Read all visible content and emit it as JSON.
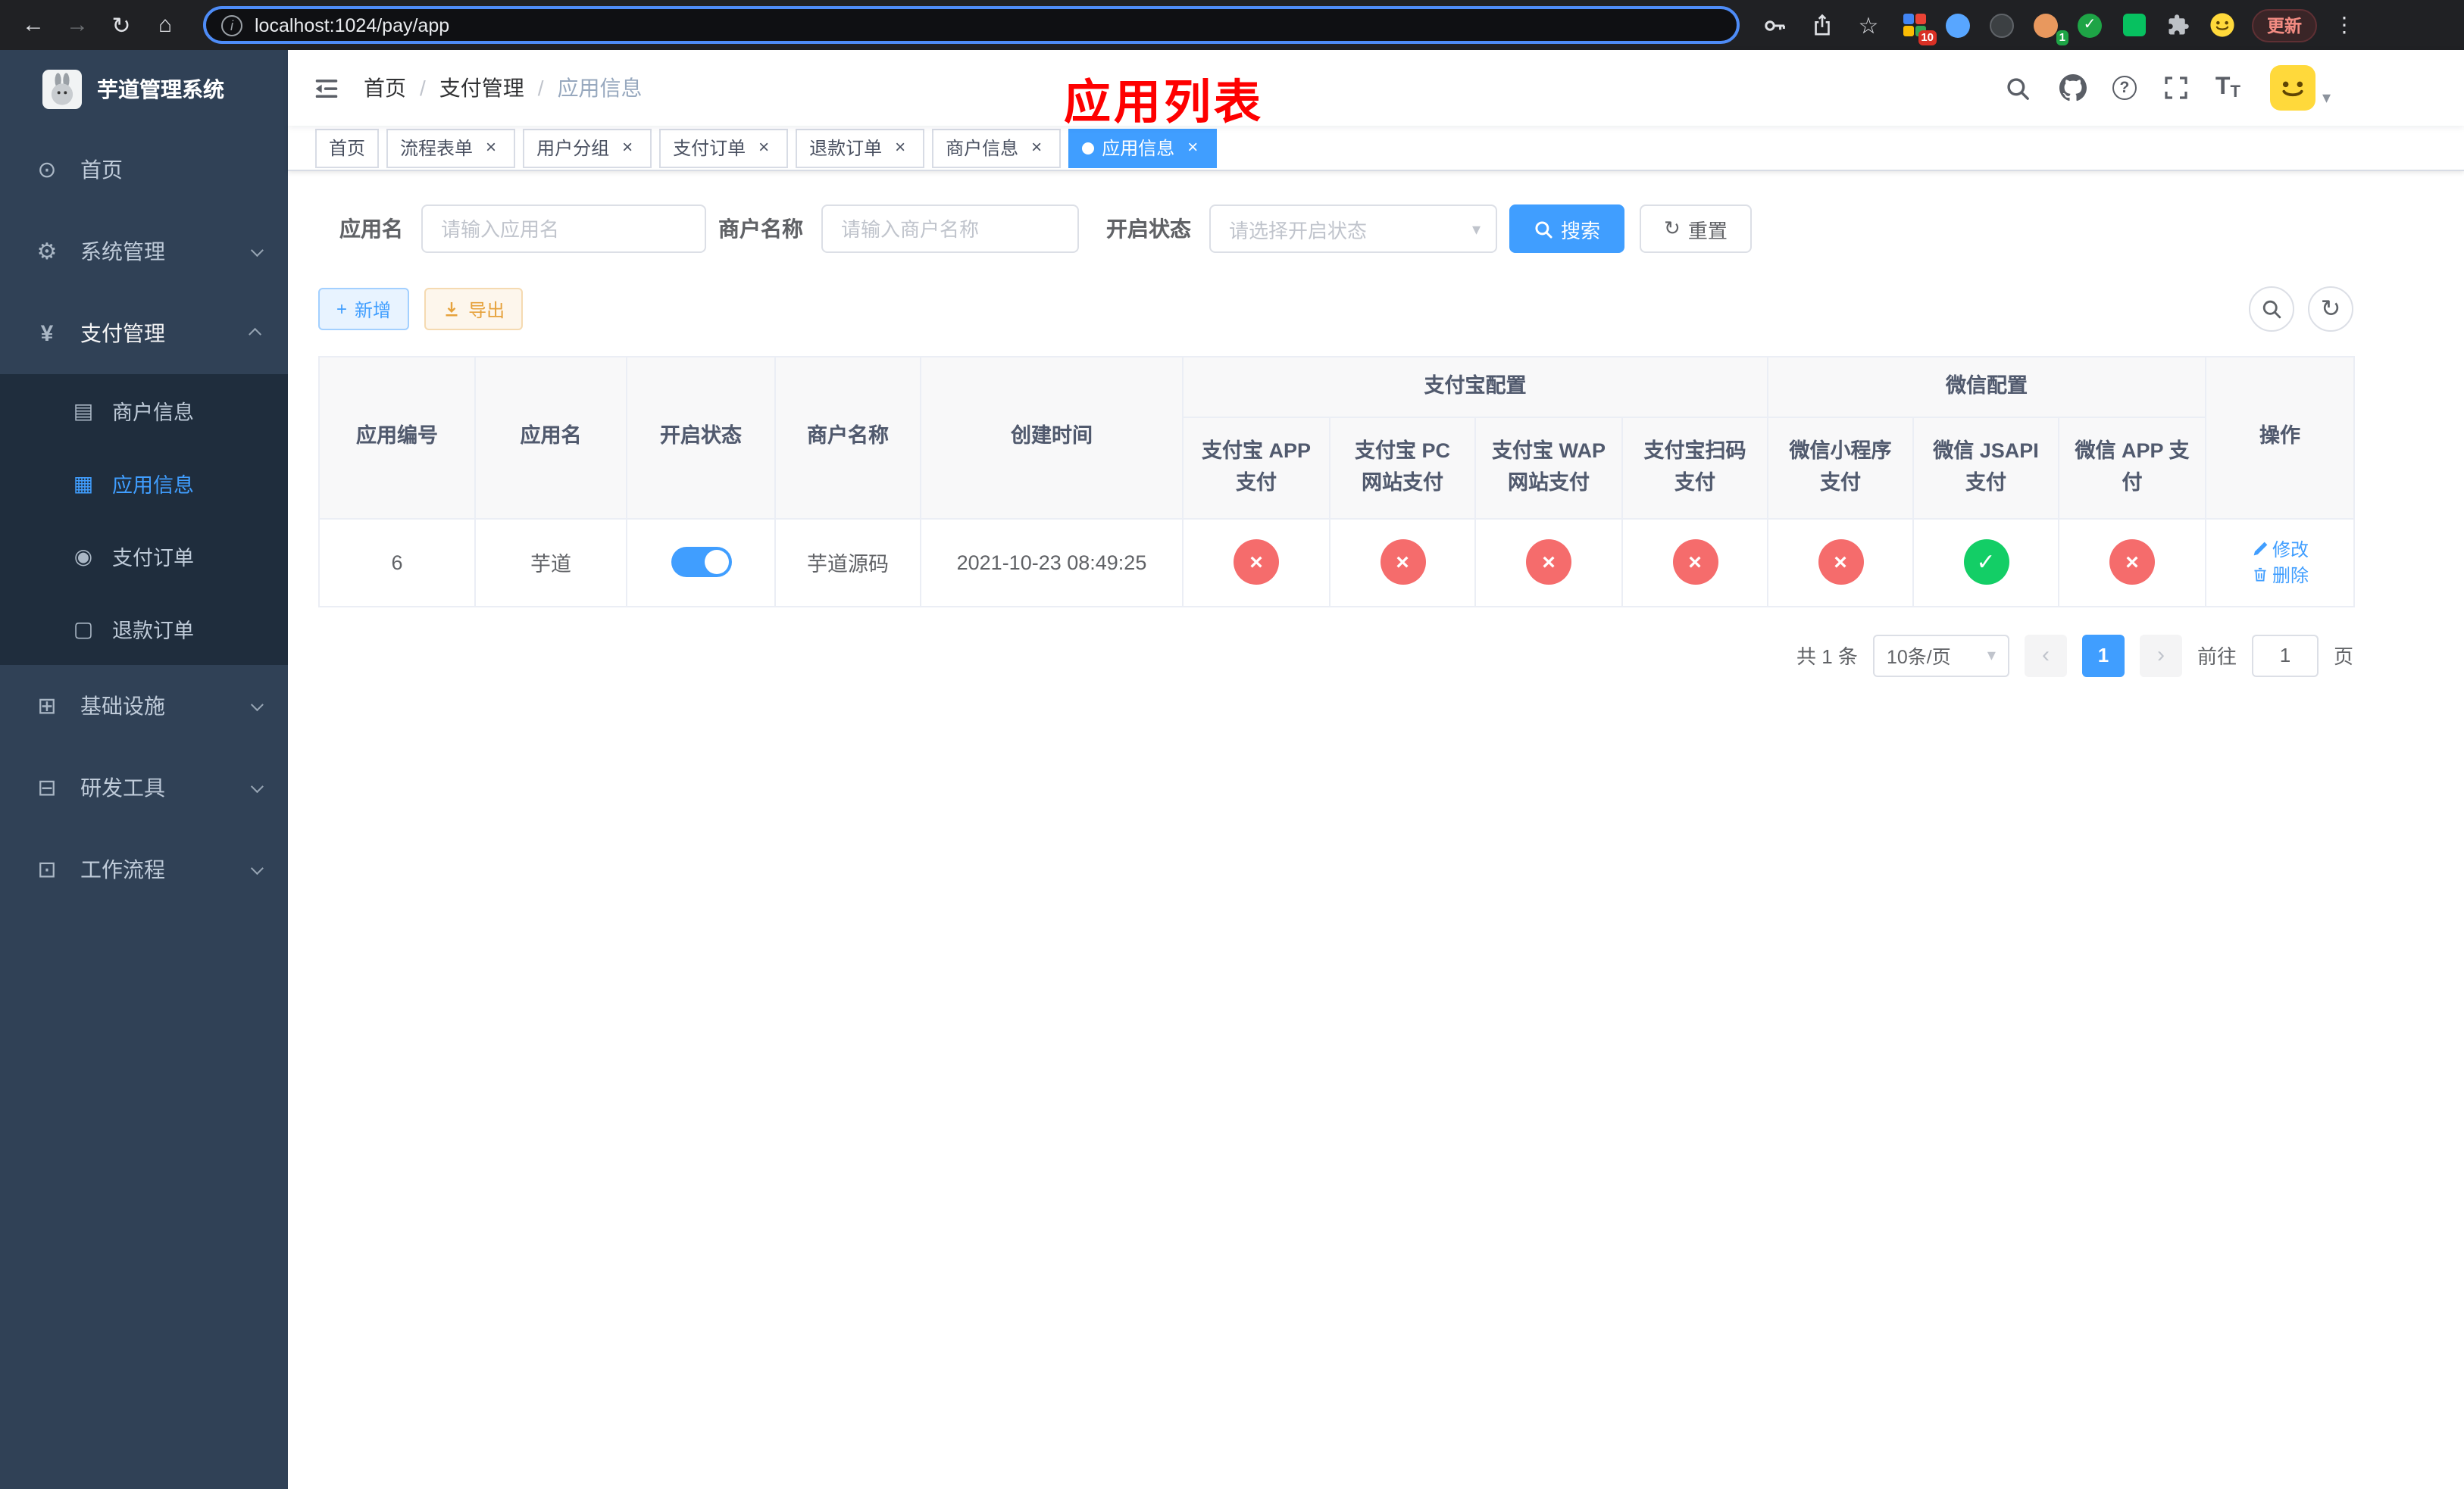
{
  "colors": {
    "accent": "#409eff",
    "fail_red": "#f56c6c",
    "pass_green": "#13ce66"
  },
  "browser": {
    "url": "localhost:1024/pay/app",
    "update_button": "更新",
    "extensions_badge": "10",
    "profile_badge": "1"
  },
  "sidebar": {
    "logo_title": "芋道管理系统",
    "menu": [
      {
        "label": "首页",
        "icon": "⊙"
      },
      {
        "label": "系统管理",
        "icon": "⚙"
      },
      {
        "label": "支付管理",
        "icon": "¥"
      },
      {
        "label": "基础设施",
        "icon": "⊞"
      },
      {
        "label": "研发工具",
        "icon": "⊟"
      },
      {
        "label": "工作流程",
        "icon": "⊡"
      }
    ],
    "submenu": [
      {
        "label": "商户信息",
        "icon": "▤"
      },
      {
        "label": "应用信息",
        "icon": "▦"
      },
      {
        "label": "支付订单",
        "icon": "◉"
      },
      {
        "label": "退款订单",
        "icon": "▢"
      }
    ]
  },
  "header": {
    "breadcrumb": [
      "首页",
      "支付管理",
      "应用信息"
    ],
    "breadcrumb_separator": "/",
    "annotation": "应用列表"
  },
  "tabs": [
    {
      "label": "首页",
      "closable": false,
      "active": false
    },
    {
      "label": "流程表单",
      "closable": true,
      "active": false
    },
    {
      "label": "用户分组",
      "closable": true,
      "active": false
    },
    {
      "label": "支付订单",
      "closable": true,
      "active": false
    },
    {
      "label": "退款订单",
      "closable": true,
      "active": false
    },
    {
      "label": "商户信息",
      "closable": true,
      "active": false
    },
    {
      "label": "应用信息",
      "closable": true,
      "active": true
    }
  ],
  "filters": {
    "app_name_label": "应用名",
    "app_name_placeholder": "请输入应用名",
    "merchant_label": "商户名称",
    "merchant_placeholder": "请输入商户名称",
    "status_label": "开启状态",
    "status_placeholder": "请选择开启状态",
    "search_button": "搜索",
    "reset_button": "重置"
  },
  "toolbar": {
    "add_button": "新增",
    "export_button": "导出"
  },
  "table": {
    "groups": {
      "alipay": "支付宝配置",
      "wechat": "微信配置"
    },
    "group_cols": [
      "应用编号",
      "应用名",
      "开启状态",
      "商户名称",
      "创建时间",
      "操作"
    ],
    "channel_cols": [
      "支付宝 APP 支付",
      "支付宝 PC 网站支付",
      "支付宝 WAP 网站支付",
      "支付宝扫码支付",
      "微信小程序支付",
      "微信 JSAPI 支付",
      "微信 APP 支付"
    ],
    "row": {
      "id": "6",
      "name": "芋道",
      "enabled": true,
      "merchant": "芋道源码",
      "created_at": "2021-10-23 08:49:25",
      "channels": [
        false,
        false,
        false,
        false,
        false,
        true,
        false
      ],
      "edit_label": "修改",
      "delete_label": "删除"
    }
  },
  "pagination": {
    "total_text": "共 1 条",
    "page_size": "10条/页",
    "page": "1",
    "goto_label": "前往",
    "goto_value": "1",
    "goto_suffix": "页"
  },
  "icons": {
    "back": "←",
    "forward": "→",
    "reload": "↻",
    "home": "⌂",
    "info": "i",
    "star": "☆",
    "menu": "⋮",
    "question": "?",
    "caret": "▾",
    "close": "×",
    "check": "✓",
    "cross": "×",
    "prev": "‹",
    "next": "›",
    "plus": "+",
    "refresh": "↻",
    "text_size": "T"
  }
}
